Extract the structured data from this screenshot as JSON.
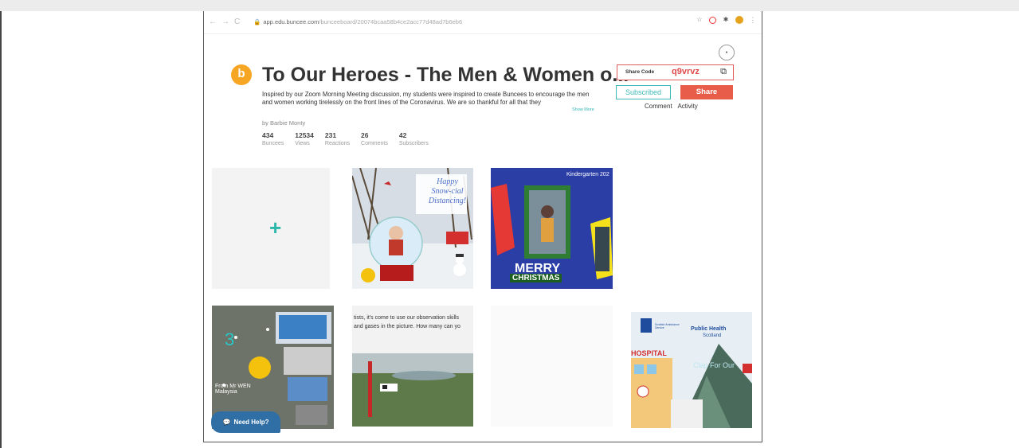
{
  "browser": {
    "url_host": "app.edu.buncee.com",
    "url_path": "/bunceeboard/20074bcaa58b4ce2acc77d48ad7b6eb6"
  },
  "board": {
    "logo_letter": "b",
    "title": "To Our Heroes - The Men & Women o...",
    "description": "Inspired by our Zoom Morning Meeting discussion, my students were inspired to create Buncees to encourage the men and women working tirelessly on the front lines of the Coronavirus. We are so thankful for all that they",
    "show_more": "Show More",
    "author": "by Barbie Monty",
    "stats": [
      {
        "value": "434",
        "label": "Buncees"
      },
      {
        "value": "12534",
        "label": "Views"
      },
      {
        "value": "231",
        "label": "Reactions"
      },
      {
        "value": "26",
        "label": "Comments"
      },
      {
        "value": "42",
        "label": "Subscribers"
      }
    ]
  },
  "actions": {
    "share_code_label": "Share Code",
    "share_code": "q9vrvz",
    "subscribed_label": "Subscribed",
    "share_label": "Share",
    "tabs": [
      "Comment",
      "Activity"
    ]
  },
  "tiles": {
    "snow_text": [
      "Happy",
      "Snow-cial",
      "Distancing!"
    ],
    "kindergarten_text": "Kindergarten 202",
    "merry": "MERRY",
    "christmas": "CHRISTMAS",
    "number_three": "3",
    "from_text": "From Mr WEN",
    "from_text2": "Malaysia",
    "observation_text": "tists, it's come to use our observation skills",
    "observation_text2": "and gases in the picture. How many can yo",
    "public_health": "Public Health",
    "scotland": "Scotland",
    "ambulance": "Scottish Ambulance Service",
    "hospital": "HOSPITAL",
    "clap": "Clap For Our"
  },
  "help": {
    "label": "Need Help?"
  },
  "colors": {
    "accent_teal": "#3fb8b8",
    "share_red": "#e85d4a",
    "logo_orange": "#f6a623"
  }
}
